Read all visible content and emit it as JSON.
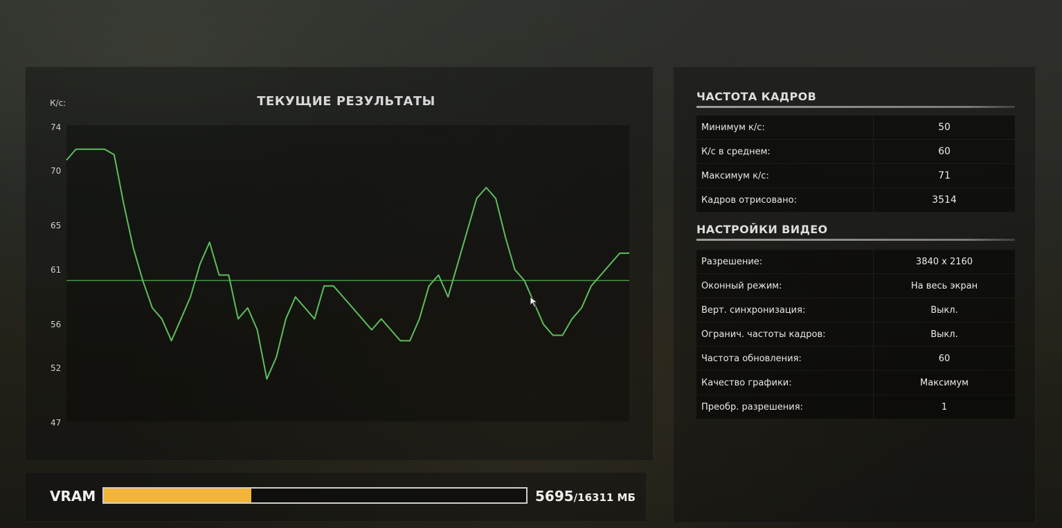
{
  "chart": {
    "title": "ТЕКУЩИЕ РЕЗУЛЬТАТЫ",
    "y_unit": "К/с:",
    "y_ticks": [
      "74",
      "70",
      "65",
      "61",
      "56",
      "52",
      "47"
    ]
  },
  "chart_data": {
    "type": "line",
    "title": "ТЕКУЩИЕ РЕЗУЛЬТАТЫ",
    "ylabel": "К/с:",
    "ylim": [
      47,
      74
    ],
    "y_ticks": [
      74,
      70,
      65,
      61,
      56,
      52,
      47
    ],
    "average_line": 60,
    "color": "#5cbf5c",
    "grid": false,
    "series": [
      {
        "values": [
          71,
          72,
          72,
          72,
          72,
          71.5,
          67,
          63,
          60,
          57.5,
          56.5,
          54.5,
          56.5,
          58.5,
          61.5,
          63.5,
          60.5,
          60.5,
          56.5,
          57.5,
          55.5,
          51,
          53,
          56.5,
          58.5,
          57.5,
          56.5,
          59.5,
          59.5,
          58.5,
          57.5,
          56.5,
          55.5,
          56.5,
          55.5,
          54.5,
          54.5,
          56.5,
          59.5,
          60.5,
          58.5,
          61.5,
          64.5,
          67.5,
          68.5,
          67.5,
          64,
          61,
          60,
          58,
          56,
          55,
          55,
          56.5,
          57.5,
          59.5,
          60.5,
          61.5,
          62.5,
          62.5
        ]
      }
    ]
  },
  "frame_rate": {
    "title": "ЧАСТОТА КАДРОВ",
    "rows": [
      {
        "label": "Минимум к/с:",
        "value": "50"
      },
      {
        "label": "К/с в среднем:",
        "value": "60"
      },
      {
        "label": "Максимум к/с:",
        "value": "71"
      },
      {
        "label": "Кадров отрисовано:",
        "value": "3514"
      }
    ]
  },
  "video_settings": {
    "title": "НАСТРОЙКИ ВИДЕО",
    "rows": [
      {
        "label": "Разрешение:",
        "value": "3840 x 2160"
      },
      {
        "label": "Оконный режим:",
        "value": "На весь экран"
      },
      {
        "label": "Верт. синхронизация:",
        "value": "Выкл."
      },
      {
        "label": "Огранич. частоты кадров:",
        "value": "Выкл."
      },
      {
        "label": "Частота обновления:",
        "value": "60"
      },
      {
        "label": "Качество графики:",
        "value": "Максимум"
      },
      {
        "label": "Преобр. разрешения:",
        "value": "1"
      }
    ]
  },
  "vram": {
    "label": "VRAM",
    "used": "5695",
    "total": "/16311 МБ",
    "used_value": 5695,
    "total_value": 16311
  },
  "colors": {
    "line": "#5cbf5c",
    "average_line": "#3f9a44",
    "vram_fill": "#f2b53a"
  }
}
